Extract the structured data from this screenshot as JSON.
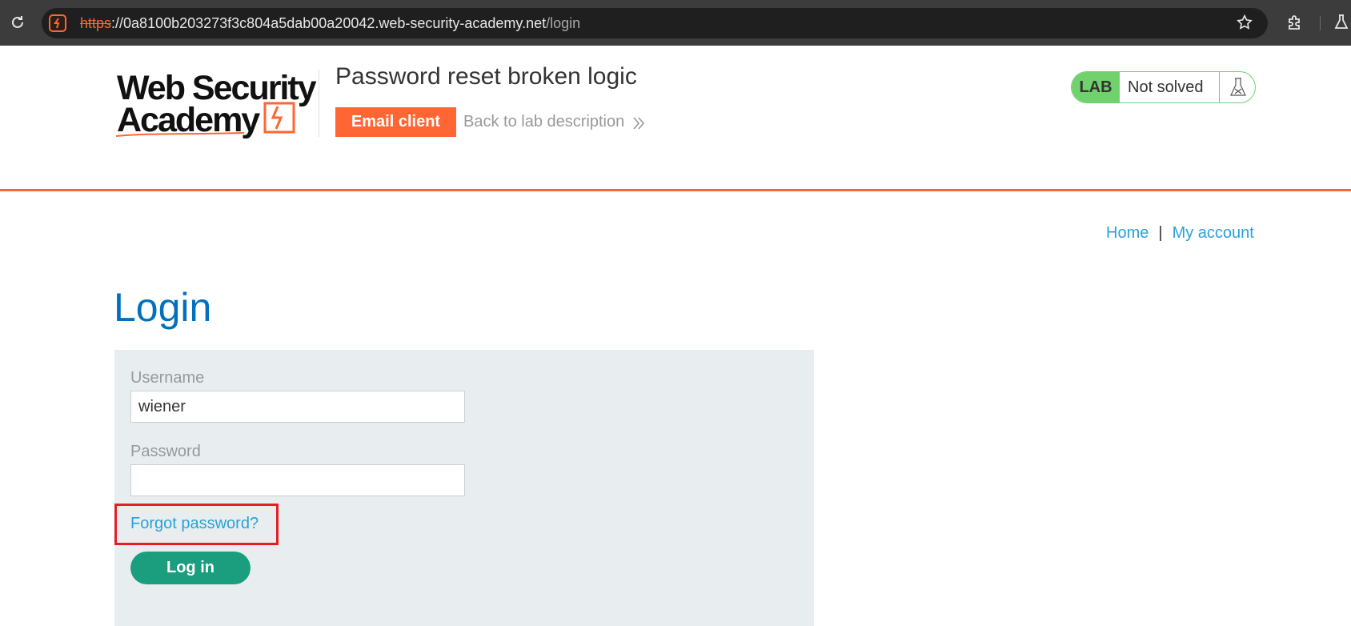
{
  "browser": {
    "url_scheme": "https",
    "url_host": "://0a8100b203273f3c804a5dab00a20042.web-security-academy.net",
    "url_path": "/login"
  },
  "header": {
    "logo_text": "Web Security Academy",
    "lab_title": "Password reset broken logic",
    "email_client_label": "Email client",
    "back_link_label": "Back to lab description",
    "lab_badge": "LAB",
    "lab_status": "Not solved"
  },
  "nav": {
    "home": "Home",
    "separator": "|",
    "my_account": "My account"
  },
  "login": {
    "title": "Login",
    "username_label": "Username",
    "username_value": "wiener",
    "password_label": "Password",
    "password_value": "",
    "forgot_password": "Forgot password?",
    "submit_label": "Log in"
  },
  "colors": {
    "accent_orange": "#ff6633",
    "link_blue": "#29a1d7",
    "title_blue": "#0071bc",
    "button_green": "#1a9e7e",
    "status_green": "#70d16d",
    "highlight_red": "#e51e25"
  }
}
